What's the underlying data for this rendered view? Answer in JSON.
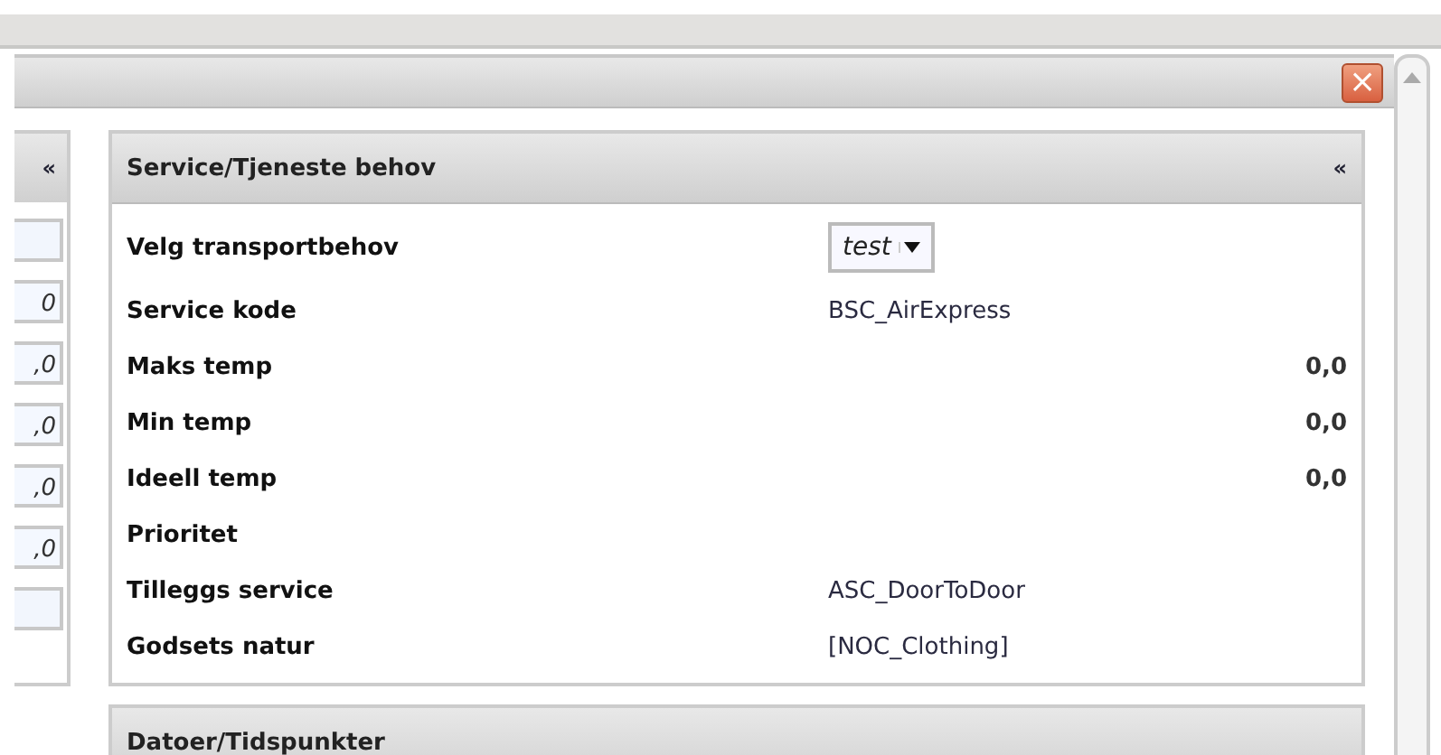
{
  "dialog": {
    "close_label": "×"
  },
  "left_panel": {
    "collapse": "«",
    "fields": [
      {
        "kind": "empty"
      },
      {
        "kind": "number",
        "value": "0"
      },
      {
        "kind": "number",
        "value": ",0"
      },
      {
        "kind": "number",
        "value": ",0"
      },
      {
        "kind": "number",
        "value": ",0"
      },
      {
        "kind": "number",
        "value": ",0"
      },
      {
        "kind": "empty"
      }
    ]
  },
  "service_panel": {
    "title": "Service/Tjeneste behov",
    "collapse": "«",
    "rows": [
      {
        "label": "Velg transportbehov",
        "kind": "select",
        "value": "test"
      },
      {
        "label": "Service kode",
        "kind": "text",
        "value": "BSC_AirExpress"
      },
      {
        "label": "Maks temp",
        "kind": "number",
        "value": "0,0"
      },
      {
        "label": "Min temp",
        "kind": "number",
        "value": "0,0"
      },
      {
        "label": "Ideell temp",
        "kind": "number",
        "value": "0,0"
      },
      {
        "label": "Prioritet",
        "kind": "text"
      },
      {
        "label": "Tilleggs service",
        "kind": "text",
        "value": "ASC_DoorToDoor"
      },
      {
        "label": "Godsets natur",
        "kind": "text",
        "value": "[NOC_Clothing]"
      }
    ]
  },
  "next_panel": {
    "title": "Datoer/Tidspunkter"
  }
}
